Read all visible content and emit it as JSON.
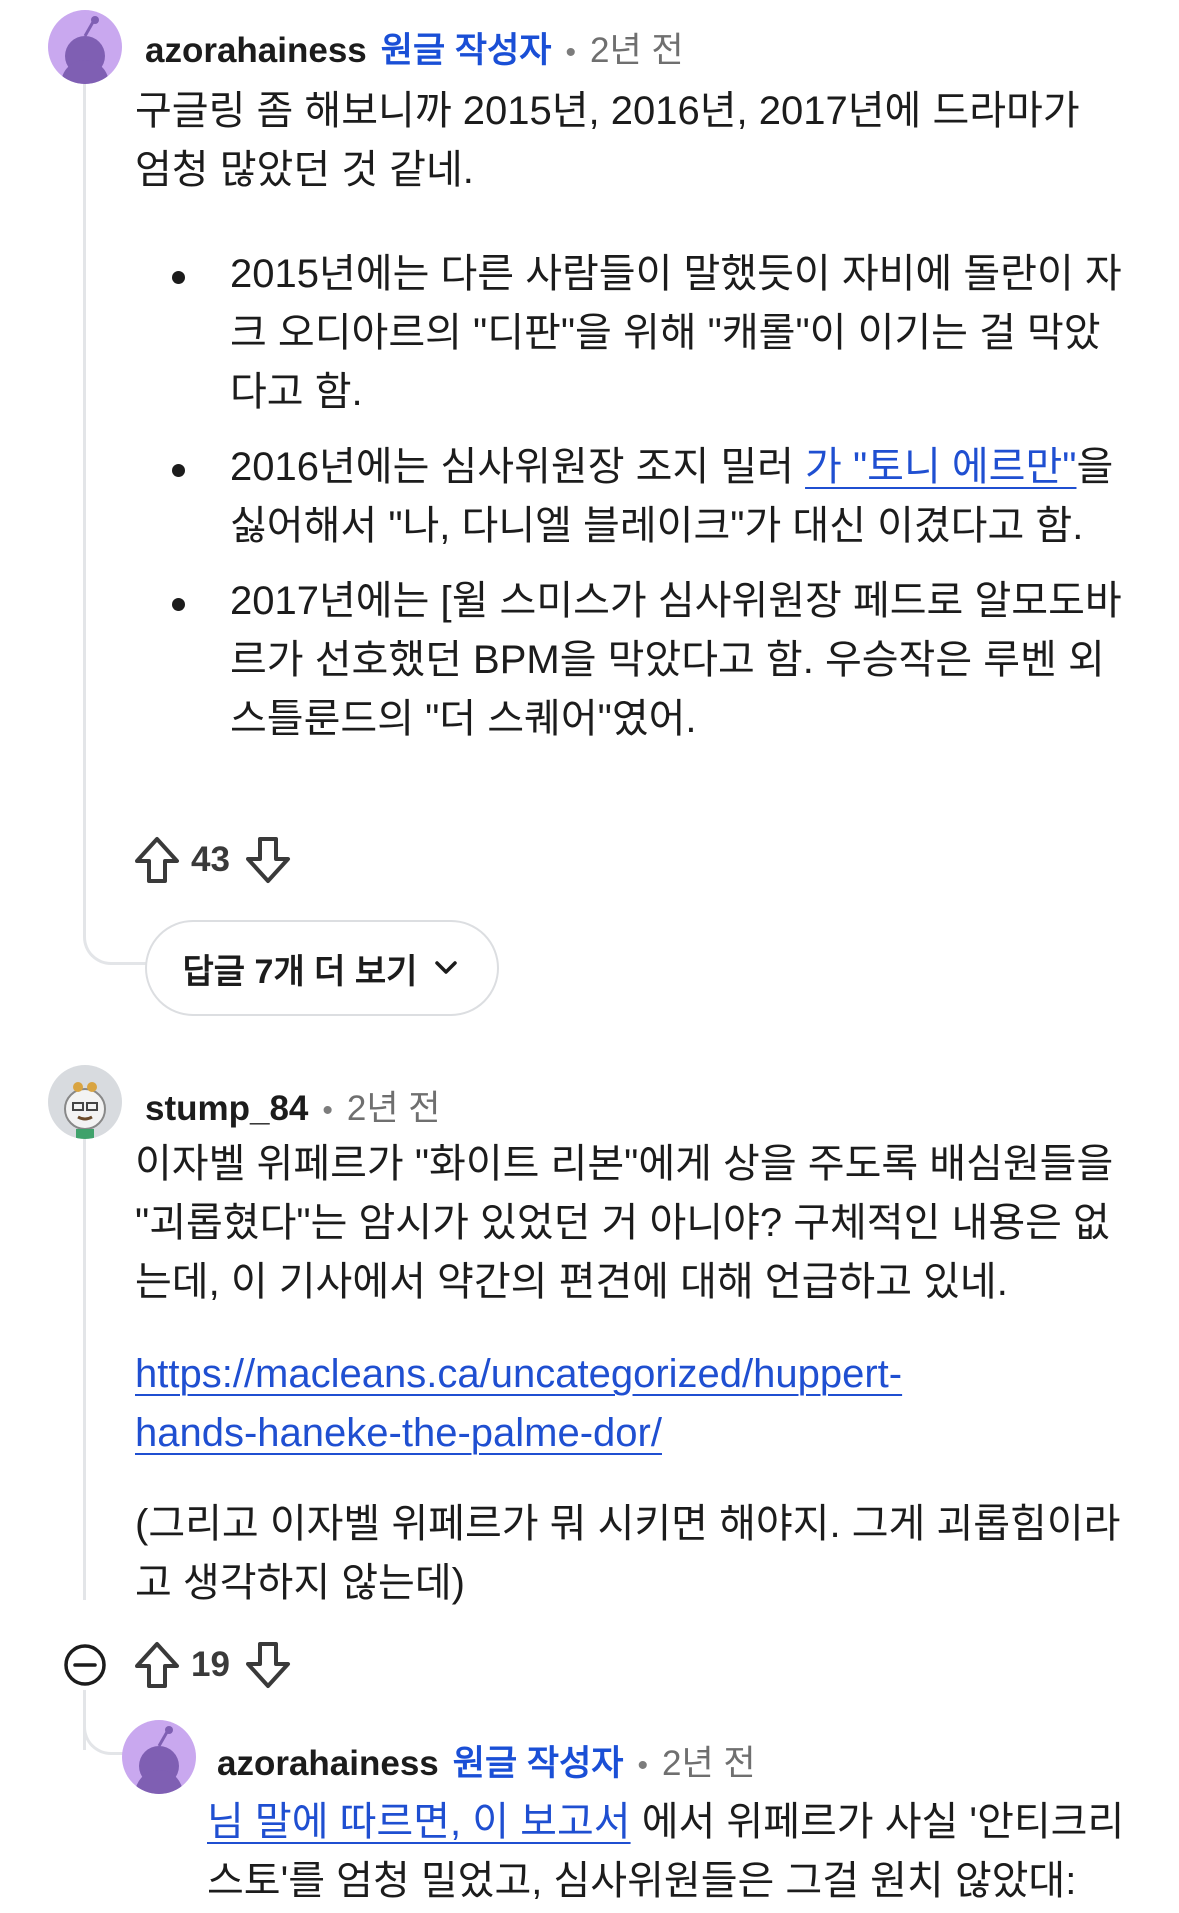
{
  "comment1": {
    "username": "azorahainess",
    "op_badge": "원글 작성자",
    "separator": "•",
    "time": "2년 전",
    "intro_line1": "구글링 좀 해보니까 2015년, 2016년, 2017년에 드라마가",
    "intro_line2": "엄청 많았던 것 같네.",
    "bullet1": "2015년에는 다른 사람들이 말했듯이 자비에 돌란이 자크 오디아르의 \"디판\"을 위해 \"캐롤\"이 이기는 걸 막았다고 함.",
    "bullet2_before": "2016년에는 심사위원장 조지 밀러 ",
    "bullet2_link": "가 \"토니 에르만\"",
    "bullet2_after": "을 싫어해서 \"나, 다니엘 블레이크\"가 대신 이겼다고 함.",
    "bullet3": "2017년에는 [윌 스미스가 심사위원장 페드로 알모도바르가 선호했던 BPM을 막았다고 함. 우승작은 루벤 외스틀룬드의 \"더 스퀘어\"였어.",
    "upvotes": "43",
    "more_replies": "답글 7개 더 보기"
  },
  "comment2": {
    "username": "stump_84",
    "separator": "•",
    "time": "2년 전",
    "text": "이자벨 위페르가 \"화이트 리본\"에게 상을 주도록 배심원들을 \"괴롭혔다\"는 암시가 있었던 거 아니야? 구체적인 내용은 없는데, 이 기사에서 약간의 편견에 대해 언급하고 있네.",
    "link_line1": "https://macleans.ca/uncategorized/huppert-",
    "link_line2": "hands-haneke-the-palme-dor/",
    "aside": "(그리고 이자벨 위페르가 뭐 시키면 해야지. 그게 괴롭힘이라고 생각하지 않는데)",
    "upvotes": "19"
  },
  "comment3": {
    "username": "azorahainess",
    "op_badge": "원글 작성자",
    "separator": "•",
    "time": "2년 전",
    "text_link": "님 말에 따르면, 이 보고서",
    "text_after": " 에서 위페르가 사실 '안티크리스토'를 엄청 밀었고, 심사위원들은 그걸 원치 않았대:"
  },
  "colors": {
    "op_badge": "#1a4fd6",
    "link": "#1f4fd1",
    "avatar_bg": "#c9a8ef",
    "thread_line": "#e3e5e8"
  }
}
